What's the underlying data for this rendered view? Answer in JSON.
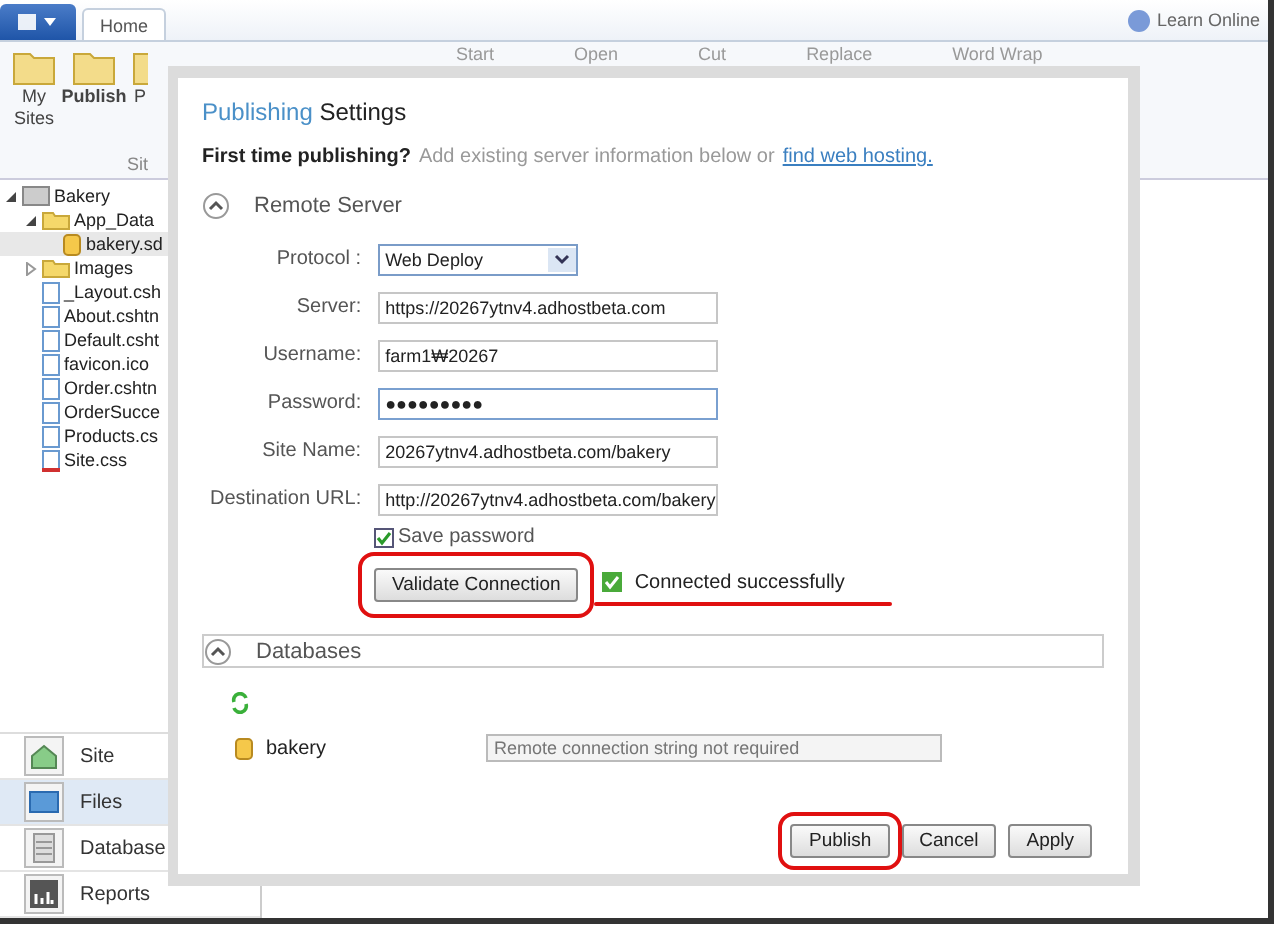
{
  "tabs": [
    {
      "label": "Home",
      "selected": true
    }
  ],
  "help": {
    "label": "Learn Online"
  },
  "ribbon": {
    "buttons": [
      {
        "label": "My Sites"
      },
      {
        "label": "Publish"
      },
      {
        "label": "P"
      }
    ],
    "group_label": "Sit",
    "faded_commands": [
      "Start",
      "Open",
      "Cut",
      "Replace",
      "Word Wrap"
    ]
  },
  "tree": [
    {
      "label": "Bakery",
      "kind": "site",
      "expanded": true,
      "children": [
        {
          "label": "App_Data",
          "kind": "folder",
          "expanded": true,
          "children": [
            {
              "label": "bakery.sd",
              "kind": "db",
              "selected": true
            }
          ]
        },
        {
          "label": "Images",
          "kind": "folder",
          "expanded": false
        },
        {
          "label": "_Layout.csh",
          "kind": "file"
        },
        {
          "label": "About.cshtn",
          "kind": "file"
        },
        {
          "label": "Default.csht",
          "kind": "file"
        },
        {
          "label": "favicon.ico",
          "kind": "file"
        },
        {
          "label": "Order.cshtn",
          "kind": "file"
        },
        {
          "label": "OrderSucce",
          "kind": "file"
        },
        {
          "label": "Products.cs",
          "kind": "file"
        },
        {
          "label": "Site.css",
          "kind": "css"
        }
      ]
    }
  ],
  "workspaces": [
    {
      "label": "Site",
      "kind": "site",
      "selected": false
    },
    {
      "label": "Files",
      "kind": "files",
      "selected": true
    },
    {
      "label": "Database",
      "kind": "database",
      "selected": false
    },
    {
      "label": "Reports",
      "kind": "reports",
      "selected": false
    }
  ],
  "dialog": {
    "title_accent": "Publishing",
    "title": "Settings",
    "intro": "First time publishing?",
    "intro_hint": "Add existing server information below or",
    "link": "find web hosting.",
    "remote_section": {
      "title": "Remote Server",
      "expanded": true
    },
    "fields": [
      {
        "label": "Protocol :",
        "kind": "dropdown",
        "value": "Web Deploy"
      },
      {
        "label": "Server:",
        "kind": "text",
        "value": "https://20267ytnv4.adhostbeta.com",
        "focused": false
      },
      {
        "label": "Username:",
        "kind": "text",
        "value": "farm1₩20267",
        "focused": false
      },
      {
        "label": "Password:",
        "kind": "password",
        "value": "●●●●●●●●●",
        "focused": true
      },
      {
        "label": "Site Name:",
        "kind": "text",
        "value": "20267ytnv4.adhostbeta.com/bakery",
        "focused": false
      },
      {
        "label": "Destination URL:",
        "kind": "text",
        "value": "http://20267ytnv4.adhostbeta.com/bakery",
        "focused": false
      }
    ],
    "save_password": {
      "label": "Save password",
      "checked": true
    },
    "validate_button": {
      "label": "Validate Connection",
      "circled": true
    },
    "status": {
      "label": "Connected successfully",
      "underlined": true
    },
    "db_section": {
      "title": "Databases",
      "expanded": true
    },
    "databases": [
      {
        "name": "bakery",
        "placeholder": "Remote connection string not required"
      }
    ],
    "buttons": [
      {
        "label": "Publish",
        "circled": true
      },
      {
        "label": "Cancel",
        "circled": false
      },
      {
        "label": "Apply",
        "circled": false
      }
    ]
  }
}
